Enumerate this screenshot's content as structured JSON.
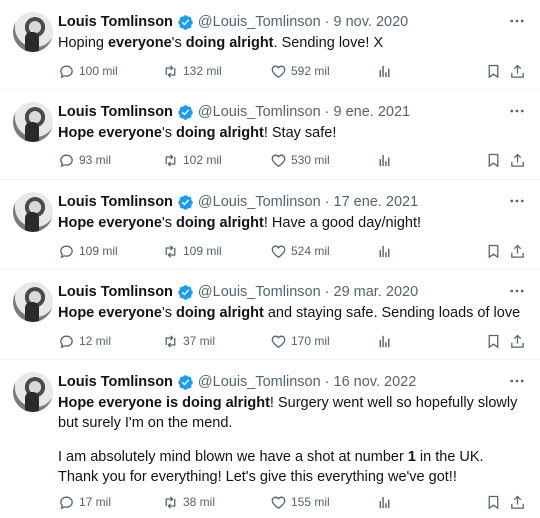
{
  "colors": {
    "text": "#0f1419",
    "muted": "#536471",
    "verified": "#1d9bf0",
    "divider": "#eff3f4"
  },
  "icons": [
    "verified-badge-icon",
    "more-icon",
    "reply-icon",
    "retweet-icon",
    "like-icon",
    "views-icon",
    "bookmark-icon",
    "share-icon"
  ],
  "tweets": [
    {
      "name": "Louis Tomlinson",
      "handle": "@Louis_Tomlinson",
      "sep": "·",
      "date": "9 nov. 2020",
      "segments": [
        {
          "t": "Hoping ",
          "b": false
        },
        {
          "t": "everyone",
          "b": true
        },
        {
          "t": "'s ",
          "b": false
        },
        {
          "t": "doing alright",
          "b": true
        },
        {
          "t": ". Sending love! X",
          "b": false
        }
      ],
      "replies": "100 mil",
      "retweets": "132 mil",
      "likes": "592 mil"
    },
    {
      "name": "Louis Tomlinson",
      "handle": "@Louis_Tomlinson",
      "sep": "·",
      "date": "9 ene. 2021",
      "segments": [
        {
          "t": "Hope everyone",
          "b": true
        },
        {
          "t": "'s ",
          "b": false
        },
        {
          "t": "doing alright",
          "b": true
        },
        {
          "t": "! Stay safe!",
          "b": false
        }
      ],
      "replies": "93 mil",
      "retweets": "102 mil",
      "likes": "530 mil"
    },
    {
      "name": "Louis Tomlinson",
      "handle": "@Louis_Tomlinson",
      "sep": "·",
      "date": "17 ene. 2021",
      "segments": [
        {
          "t": "Hope everyone",
          "b": true
        },
        {
          "t": "'s ",
          "b": false
        },
        {
          "t": "doing alright",
          "b": true
        },
        {
          "t": "! Have a good day/night!",
          "b": false
        }
      ],
      "replies": "109 mil",
      "retweets": "109 mil",
      "likes": "524 mil"
    },
    {
      "name": "Louis Tomlinson",
      "handle": "@Louis_Tomlinson",
      "sep": "·",
      "date": "29 mar. 2020",
      "segments": [
        {
          "t": "Hope everyone",
          "b": true
        },
        {
          "t": "'s ",
          "b": false
        },
        {
          "t": "doing alright",
          "b": true
        },
        {
          "t": " and staying safe. Sending loads of love",
          "b": false
        }
      ],
      "replies": "12 mil",
      "retweets": "37 mil",
      "likes": "170 mil"
    },
    {
      "name": "Louis Tomlinson",
      "handle": "@Louis_Tomlinson",
      "sep": "·",
      "date": "16 nov. 2022",
      "segments": [
        {
          "t": "Hope everyone is doing alright",
          "b": true
        },
        {
          "t": "! Surgery went well so hopefully slowly but surely I'm on the mend.",
          "b": false
        },
        {
          "br": true
        },
        {
          "t": "I am absolutely mind blown we have a shot at number ",
          "b": false
        },
        {
          "t": "1",
          "b": true
        },
        {
          "t": " in the UK. Thank you for everything! Let's give this everything we've got!!",
          "b": false
        }
      ],
      "replies": "17 mil",
      "retweets": "38 mil",
      "likes": "155 mil"
    }
  ]
}
